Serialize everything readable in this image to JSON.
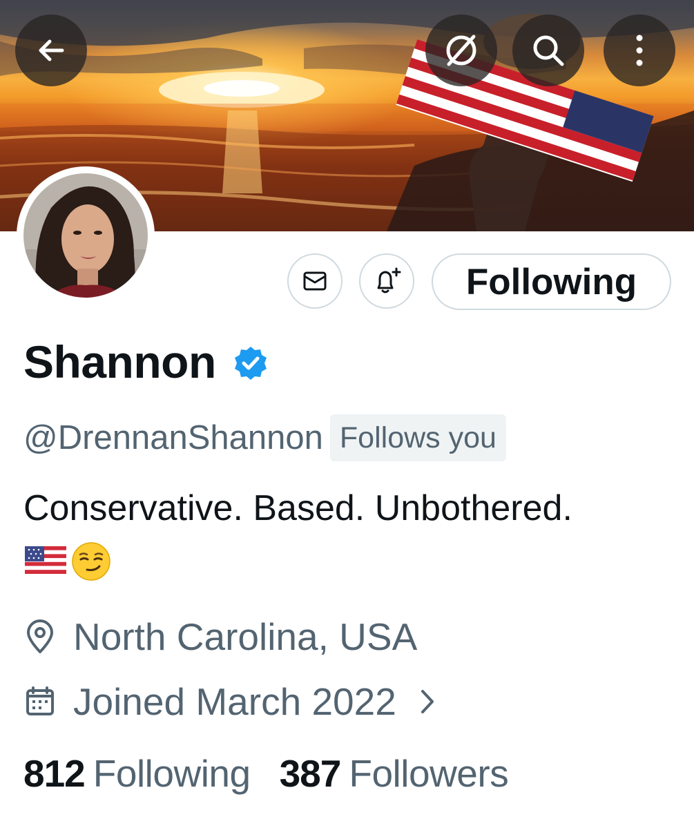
{
  "header": {
    "back_icon": "arrow-left-icon",
    "grok_icon": "grok-icon",
    "search_icon": "search-icon",
    "more_icon": "more-vertical-icon"
  },
  "profile": {
    "name": "Shannon",
    "verified": true,
    "handle": "@DrennanShannon",
    "follows_you_label": "Follows you",
    "bio": "Conservative. Based. Unbothered.",
    "bio_emojis": [
      "us-flag-emoji",
      "smirking-face-emoji"
    ],
    "location": "North Carolina, USA",
    "joined": "Joined March 2022",
    "following_count": "812",
    "following_label": "Following",
    "followers_count": "387",
    "followers_label": "Followers"
  },
  "actions": {
    "message_icon": "mail-icon",
    "notify_icon": "bell-plus-icon",
    "follow_button_label": "Following"
  },
  "colors": {
    "verified": "#1d9bf0",
    "secondary_text": "#536471",
    "primary_text": "#0f1419",
    "border": "#cfd9de"
  }
}
